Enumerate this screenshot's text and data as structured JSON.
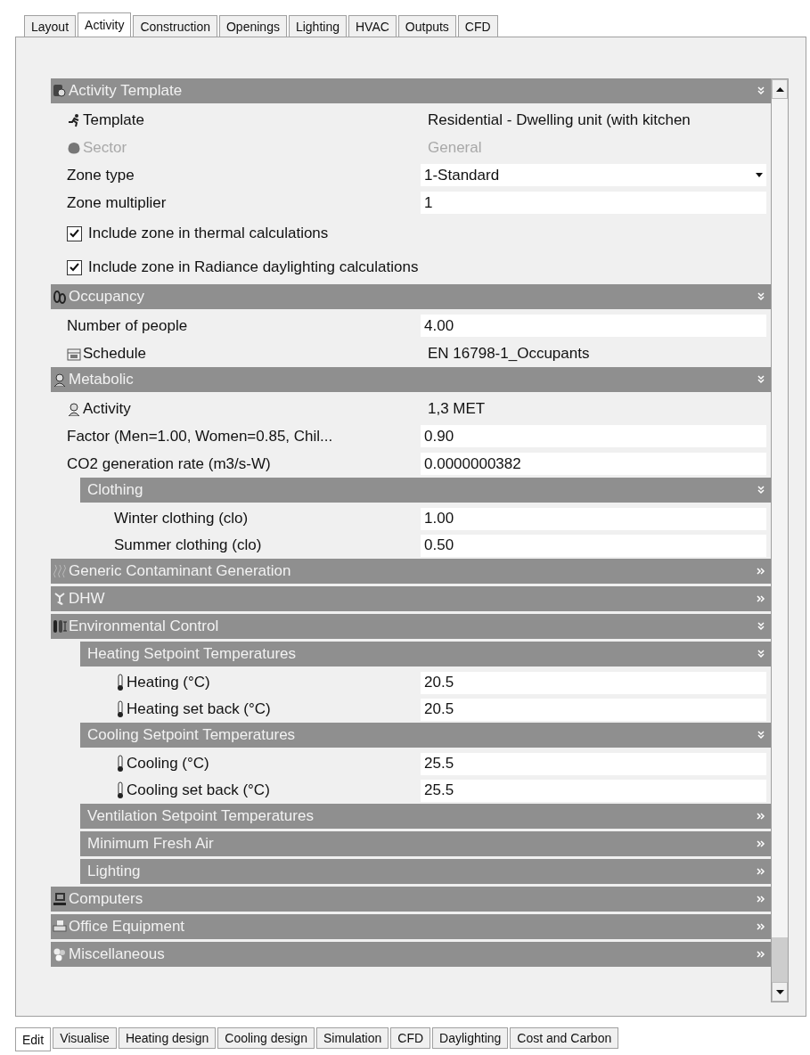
{
  "top_tabs": [
    {
      "label": "Layout",
      "selected": false
    },
    {
      "label": "Activity",
      "selected": true
    },
    {
      "label": "Construction",
      "selected": false
    },
    {
      "label": "Openings",
      "selected": false
    },
    {
      "label": "Lighting",
      "selected": false
    },
    {
      "label": "HVAC",
      "selected": false
    },
    {
      "label": "Outputs",
      "selected": false
    },
    {
      "label": "CFD",
      "selected": false
    }
  ],
  "sections": [
    {
      "kind": "section",
      "title": "Activity Template",
      "expanded": true,
      "children": [
        {
          "kind": "text",
          "label": "Template",
          "value": "Residential - Dwelling unit (with kitchen",
          "disabled": false
        },
        {
          "kind": "text",
          "label": "Sector",
          "value": "General",
          "disabled": true
        },
        {
          "kind": "dropdown",
          "label": "Zone type",
          "value": "1-Standard",
          "disabled": false
        },
        {
          "kind": "input",
          "label": "Zone multiplier",
          "value": "1",
          "disabled": false
        },
        {
          "kind": "checkbox",
          "label": "Include zone in thermal calculations",
          "checked": true
        },
        {
          "kind": "checkbox",
          "label": "Include zone in Radiance daylighting calculations",
          "checked": true
        }
      ]
    },
    {
      "kind": "section",
      "title": "Occupancy",
      "expanded": true,
      "children": [
        {
          "kind": "input",
          "label": "Number of people",
          "value": "4.00",
          "disabled": false
        },
        {
          "kind": "text",
          "label": "Schedule",
          "value": "EN 16798-1_Occupants",
          "disabled": false
        }
      ]
    },
    {
      "kind": "section",
      "title": "Metabolic",
      "expanded": true,
      "children": [
        {
          "kind": "text",
          "label": "Activity",
          "value": "1,3 MET",
          "disabled": false
        },
        {
          "kind": "input",
          "label": "Factor (Men=1.00, Women=0.85, Chil...",
          "value": "0.90",
          "disabled": false
        },
        {
          "kind": "input",
          "label": "CO2 generation rate (m3/s-W)",
          "value": "0.0000000382",
          "disabled": false
        },
        {
          "kind": "section",
          "title": "Clothing",
          "expanded": true,
          "children": [
            {
              "kind": "input",
              "label": "Winter clothing (clo)",
              "value": "1.00",
              "disabled": false
            },
            {
              "kind": "input",
              "label": "Summer clothing (clo)",
              "value": "0.50",
              "disabled": false
            }
          ]
        }
      ]
    },
    {
      "kind": "section",
      "title": "Generic Contaminant Generation",
      "expanded": false
    },
    {
      "kind": "section",
      "title": "DHW",
      "expanded": false
    },
    {
      "kind": "section",
      "title": "Environmental Control",
      "expanded": true,
      "children": [
        {
          "kind": "section",
          "title": "Heating Setpoint Temperatures",
          "expanded": true,
          "children": [
            {
              "kind": "input",
              "label": "Heating (°C)",
              "value": "20.5",
              "disabled": false
            },
            {
              "kind": "input",
              "label": "Heating set back (°C)",
              "value": "20.5",
              "disabled": false
            }
          ]
        },
        {
          "kind": "section",
          "title": "Cooling Setpoint Temperatures",
          "expanded": true,
          "children": [
            {
              "kind": "input",
              "label": "Cooling (°C)",
              "value": "25.5",
              "disabled": false
            },
            {
              "kind": "input",
              "label": "Cooling set back (°C)",
              "value": "25.5",
              "disabled": false
            }
          ]
        },
        {
          "kind": "section",
          "title": "Ventilation Setpoint Temperatures",
          "expanded": false
        },
        {
          "kind": "section",
          "title": "Minimum Fresh Air",
          "expanded": false
        },
        {
          "kind": "section",
          "title": "Lighting",
          "expanded": false
        }
      ]
    },
    {
      "kind": "section",
      "title": "Computers",
      "expanded": false
    },
    {
      "kind": "section",
      "title": "Office Equipment",
      "expanded": false
    },
    {
      "kind": "section",
      "title": "Miscellaneous",
      "expanded": false
    }
  ],
  "bottom_tabs": [
    {
      "label": "Edit",
      "selected": true
    },
    {
      "label": "Visualise",
      "selected": false
    },
    {
      "label": "Heating design",
      "selected": false
    },
    {
      "label": "Cooling design",
      "selected": false
    },
    {
      "label": "Simulation",
      "selected": false
    },
    {
      "label": "CFD",
      "selected": false
    },
    {
      "label": "Daylighting",
      "selected": false
    },
    {
      "label": "Cost and Carbon",
      "selected": false
    }
  ]
}
